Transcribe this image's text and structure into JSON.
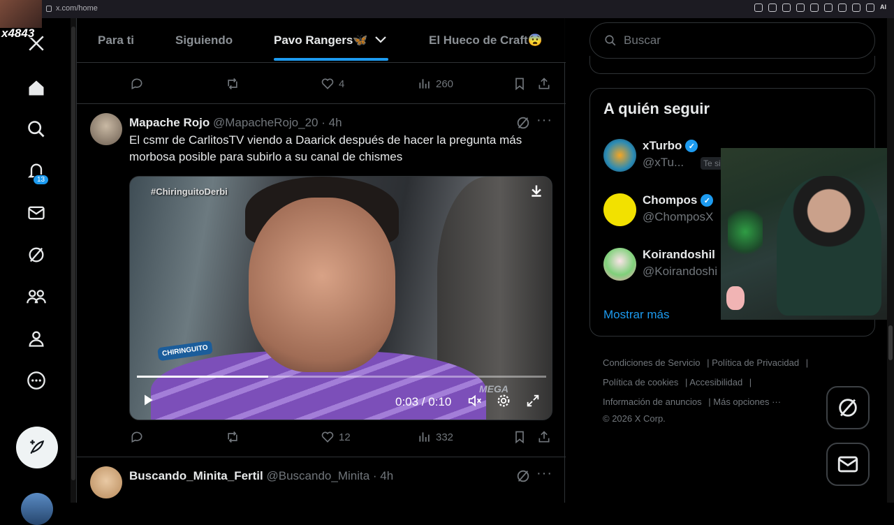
{
  "browser": {
    "url": "x.com/home",
    "extension_label": "AI"
  },
  "stream_overlay": {
    "tag": "x4843"
  },
  "sidebar": {
    "notification_count": "13"
  },
  "tabs": [
    {
      "label": "Para ti"
    },
    {
      "label": "Siguiendo"
    },
    {
      "label": "Pavo Rangers🦋"
    },
    {
      "label": "El Hueco de Craft😨"
    }
  ],
  "prev_post": {
    "likes": "4",
    "views": "260"
  },
  "post1": {
    "name": "Mapache Rojo",
    "handle": "@MapacheRojo_20",
    "time": "· 4h",
    "text": "El csmr de CarlitosTV viendo a Daarick después de hacer la pregunta más morbosa posible para subirlo a su canal de chismes",
    "video": {
      "watermark": "#ChiringuitoDerbi",
      "logo": "CHIRINGUITO",
      "channel": "MEGA",
      "time": "0:03 / 0:10",
      "progress": 0.32
    },
    "likes": "12",
    "views": "332"
  },
  "post2": {
    "name": "Buscando_Minita_Fertil",
    "handle": "@Buscando_Minita",
    "time": "· 4h"
  },
  "search": {
    "placeholder": "Buscar"
  },
  "who_to_follow": {
    "title": "A quién seguir",
    "users": [
      {
        "name": "xTurbo",
        "handle": "@xTu...",
        "follows_you": "Te sigue",
        "verified": true
      },
      {
        "name": "Chompos",
        "handle": "@ChomposX",
        "verified": true
      },
      {
        "name": "Koirandoshil",
        "handle": "@Koirandoshi",
        "verified": false
      }
    ],
    "show_more": "Mostrar más"
  },
  "footer": {
    "links": [
      "Condiciones de Servicio",
      "Política de Privacidad",
      "Política de cookies",
      "Accesibilidad",
      "Información de anuncios",
      "Más opciones ···"
    ],
    "copyright": "© 2026 X Corp."
  },
  "colors": {
    "accent": "#1d9bf0",
    "background": "#000000",
    "border": "#2f3336",
    "muted": "#71767b"
  }
}
